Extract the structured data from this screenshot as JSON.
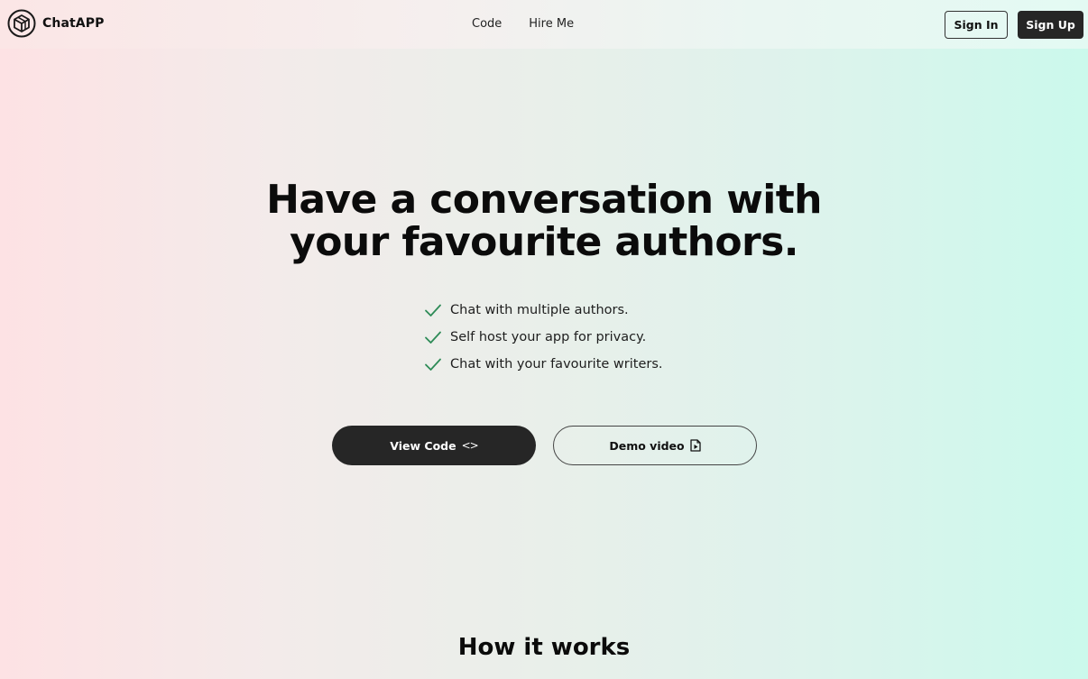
{
  "brand": {
    "name": "ChatAPP",
    "logo_icon": "cube-logo-icon"
  },
  "nav": {
    "links": [
      "Code",
      "Hire Me"
    ]
  },
  "auth": {
    "signin_label": "Sign In",
    "signup_label": "Sign Up"
  },
  "hero": {
    "title_line1": "Have a conversation with",
    "title_line2": "your favourite authors.",
    "features": [
      "Chat with multiple authors.",
      "Self host your app for privacy.",
      "Chat with your favourite writers."
    ],
    "feature_icon": "check-icon",
    "check_color": "#2e8b57"
  },
  "cta": {
    "view_code_label": "View Code",
    "view_code_icon": "<>",
    "demo_label": "Demo video",
    "demo_icon": "video-file-icon"
  },
  "how_it_works": {
    "title": "How it works"
  },
  "colors": {
    "bg_left": "#fde2e4",
    "bg_right": "#cbf9ec",
    "dark_button": "#262626"
  }
}
